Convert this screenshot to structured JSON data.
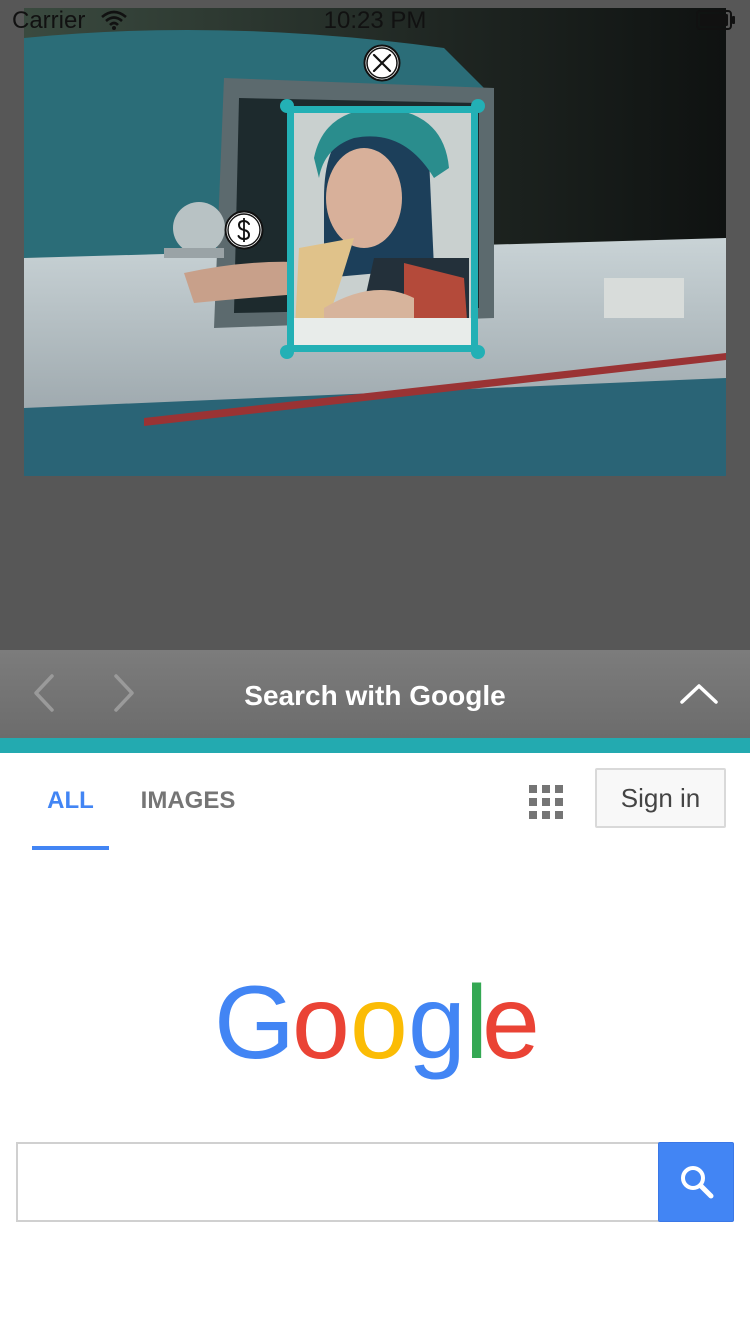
{
  "status_bar": {
    "carrier": "Carrier",
    "time": "10:23 PM"
  },
  "toolbar": {
    "title": "Search with Google",
    "back_icon": "chevron-left-icon",
    "forward_icon": "chevron-right-icon",
    "collapse_icon": "chevron-up-icon"
  },
  "tabs": [
    {
      "label": "ALL",
      "active": true
    },
    {
      "label": "IMAGES",
      "active": false
    }
  ],
  "header": {
    "signin_label": "Sign in",
    "apps_icon": "apps-grid-icon"
  },
  "logo": {
    "text": "Google",
    "letters": [
      "G",
      "o",
      "o",
      "g",
      "l",
      "e"
    ]
  },
  "search": {
    "value": "",
    "placeholder": "",
    "button_icon": "search-icon"
  },
  "colors": {
    "accent": "#23b0b5",
    "google_blue": "#4285f4",
    "google_red": "#ea4335",
    "google_yellow": "#fbbc05",
    "google_green": "#34a853",
    "toolbar": "#727272"
  }
}
